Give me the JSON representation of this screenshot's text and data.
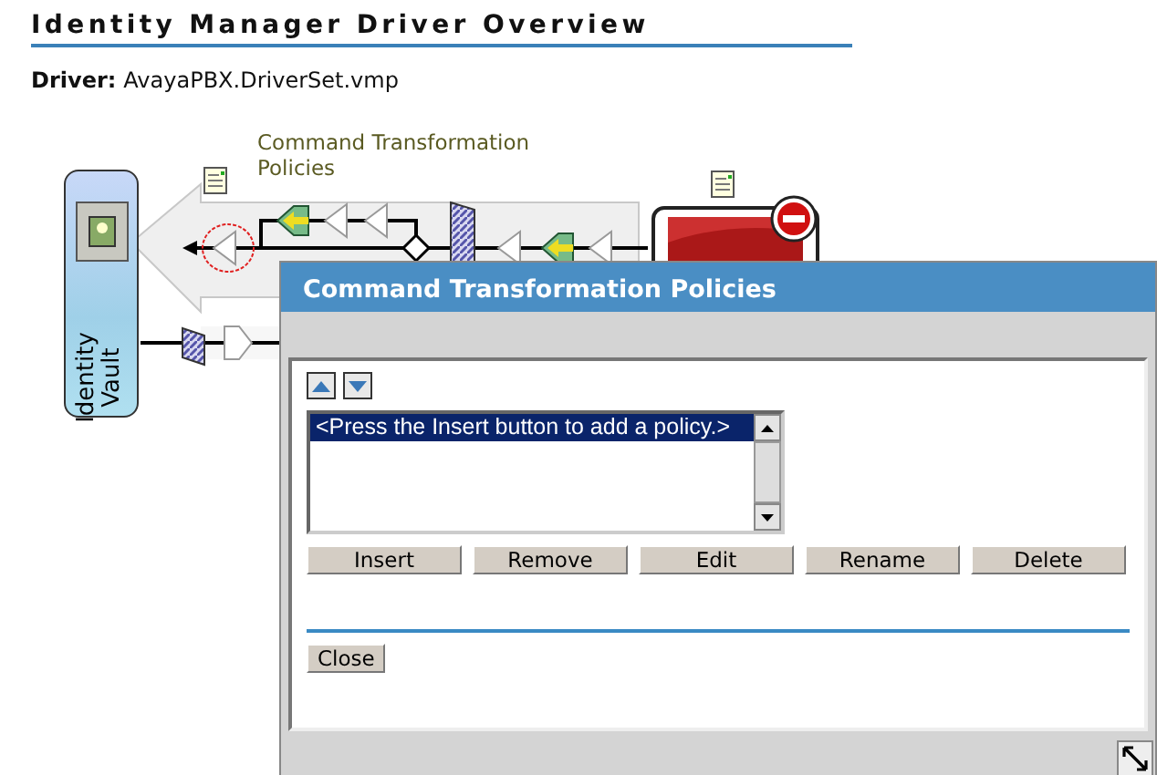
{
  "page": {
    "title": "Identity Manager Driver Overview",
    "driver_label": "Driver:",
    "driver_value": "AvayaPBX.DriverSet.vmp"
  },
  "diagram": {
    "policy_label": "Command Transformation Policies",
    "vault_label": "Identity Vault"
  },
  "dialog": {
    "title": "Command Transformation Policies",
    "list_items": [
      {
        "label": "<Press the Insert button to add a policy.>",
        "selected": true
      }
    ],
    "actions": [
      "Insert",
      "Remove",
      "Edit",
      "Rename",
      "Delete"
    ],
    "close": "Close"
  }
}
